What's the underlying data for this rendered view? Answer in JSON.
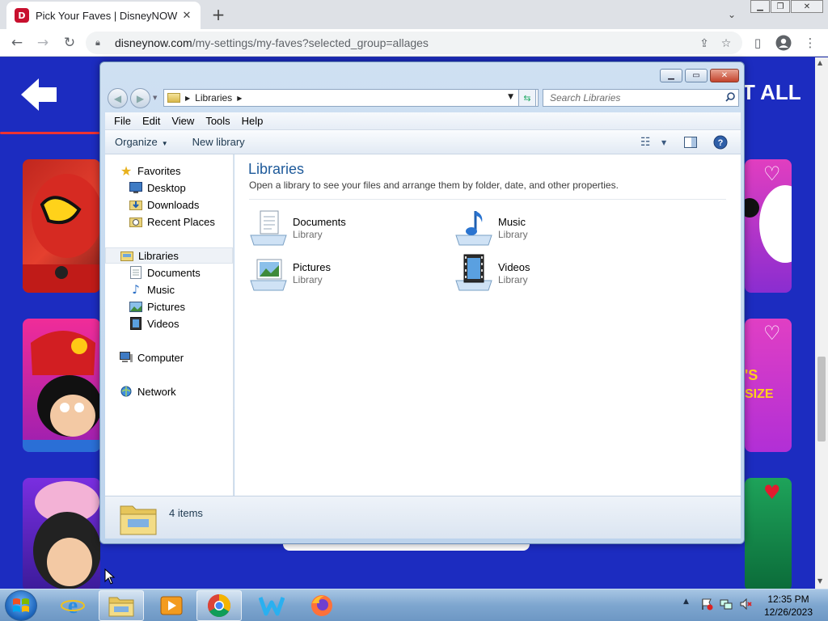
{
  "browser": {
    "tab_title": "Pick Your Faves | DisneyNOW",
    "tab_favicon": "D",
    "new_tab": "+",
    "url_host": "disneynow.com",
    "url_path": "/my-settings/my-faves?selected_group=allages"
  },
  "page": {
    "select_all": "T ALL"
  },
  "explorer": {
    "address_crumb": "Libraries",
    "search_placeholder": "Search Libraries",
    "menu": [
      "File",
      "Edit",
      "View",
      "Tools",
      "Help"
    ],
    "commands": {
      "organize": "Organize",
      "new_library": "New library"
    },
    "nav": {
      "favorites": "Favorites",
      "desktop": "Desktop",
      "downloads": "Downloads",
      "recent_places": "Recent Places",
      "libraries": "Libraries",
      "documents": "Documents",
      "music": "Music",
      "pictures": "Pictures",
      "videos": "Videos",
      "computer": "Computer",
      "network": "Network"
    },
    "content": {
      "title": "Libraries",
      "description": "Open a library to see your files and arrange them by folder, date, and other properties.",
      "items": [
        {
          "name": "Documents",
          "type": "Library"
        },
        {
          "name": "Music",
          "type": "Library"
        },
        {
          "name": "Pictures",
          "type": "Library"
        },
        {
          "name": "Videos",
          "type": "Library"
        }
      ]
    },
    "status": "4 items"
  },
  "taskbar": {
    "time": "12:35 PM",
    "date": "12/26/2023"
  }
}
